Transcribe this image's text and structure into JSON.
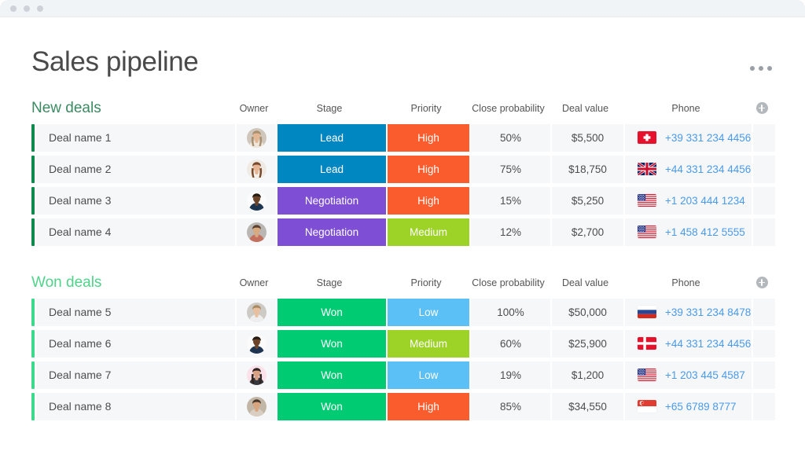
{
  "window": {
    "traffic_lights": [
      "close",
      "minimize",
      "maximize"
    ]
  },
  "header": {
    "title": "Sales pipeline",
    "more_menu": "more-options"
  },
  "columns": {
    "name": "",
    "owner": "Owner",
    "stage": "Stage",
    "priority": "Priority",
    "probability": "Close probability",
    "value": "Deal value",
    "phone": "Phone",
    "add": "+"
  },
  "colors": {
    "accent_new": "#0f8a4e",
    "accent_won": "#3fd98b",
    "title_new": "#3a8a62",
    "title_won": "#4fd38a",
    "stage_lead": "#0086c0",
    "stage_negotiation": "#7e4fd4",
    "stage_won": "#00ca72",
    "priority_high": "#fb5c2d",
    "priority_medium": "#9cd326",
    "priority_low": "#5bc0f5",
    "phone_link": "#4a9ae8",
    "cell_bg": "#f6f7f8",
    "page_title": "#4a4a4a"
  },
  "sections": [
    {
      "id": "new-deals",
      "title": "New deals",
      "accent": "new",
      "rows": [
        {
          "name": "Deal name 1",
          "owner": "avatar-woman-blonde",
          "stage": "Lead",
          "stage_color": "#0086c0",
          "priority": "High",
          "priority_color": "#fb5c2d",
          "probability": "50%",
          "value": "$5,500",
          "flag": "switzerland-flag",
          "phone": "+39 331 234 4456"
        },
        {
          "name": "Deal name 2",
          "owner": "avatar-woman-brunette",
          "stage": "Lead",
          "stage_color": "#0086c0",
          "priority": "High",
          "priority_color": "#fb5c2d",
          "probability": "75%",
          "value": "$18,750",
          "flag": "united-kingdom-flag",
          "phone": "+44 331 234 4456"
        },
        {
          "name": "Deal name 3",
          "owner": "avatar-man-dark-shirt",
          "stage": "Negotiation",
          "stage_color": "#7e4fd4",
          "priority": "High",
          "priority_color": "#fb5c2d",
          "probability": "15%",
          "value": "$5,250",
          "flag": "united-states-flag",
          "phone": "+1 203 444 1234"
        },
        {
          "name": "Deal name 4",
          "owner": "avatar-man-beard",
          "stage": "Negotiation",
          "stage_color": "#7e4fd4",
          "priority": "Medium",
          "priority_color": "#9cd326",
          "probability": "12%",
          "value": "$2,700",
          "flag": "united-states-flag",
          "phone": "+1 458 412 5555"
        }
      ]
    },
    {
      "id": "won-deals",
      "title": "Won deals",
      "accent": "won",
      "rows": [
        {
          "name": "Deal name 5",
          "owner": "avatar-man-blond",
          "stage": "Won",
          "stage_color": "#00ca72",
          "priority": "Low",
          "priority_color": "#5bc0f5",
          "probability": "100%",
          "value": "$50,000",
          "flag": "russia-flag",
          "phone": "+39 331 234 8478"
        },
        {
          "name": "Deal name 6",
          "owner": "avatar-man-dark-shirt",
          "stage": "Won",
          "stage_color": "#00ca72",
          "priority": "Medium",
          "priority_color": "#9cd326",
          "probability": "60%",
          "value": "$25,900",
          "flag": "denmark-flag",
          "phone": "+44 331 234 4456"
        },
        {
          "name": "Deal name 7",
          "owner": "avatar-woman-pink-bg",
          "stage": "Won",
          "stage_color": "#00ca72",
          "priority": "Low",
          "priority_color": "#5bc0f5",
          "probability": "19%",
          "value": "$1,200",
          "flag": "united-states-flag",
          "phone": "+1 203 445 4587"
        },
        {
          "name": "Deal name 8",
          "owner": "avatar-woman-short-hair",
          "stage": "Won",
          "stage_color": "#00ca72",
          "priority": "High",
          "priority_color": "#fb5c2d",
          "probability": "85%",
          "value": "$34,550",
          "flag": "singapore-flag",
          "phone": "+65 6789 8777"
        }
      ]
    }
  ]
}
